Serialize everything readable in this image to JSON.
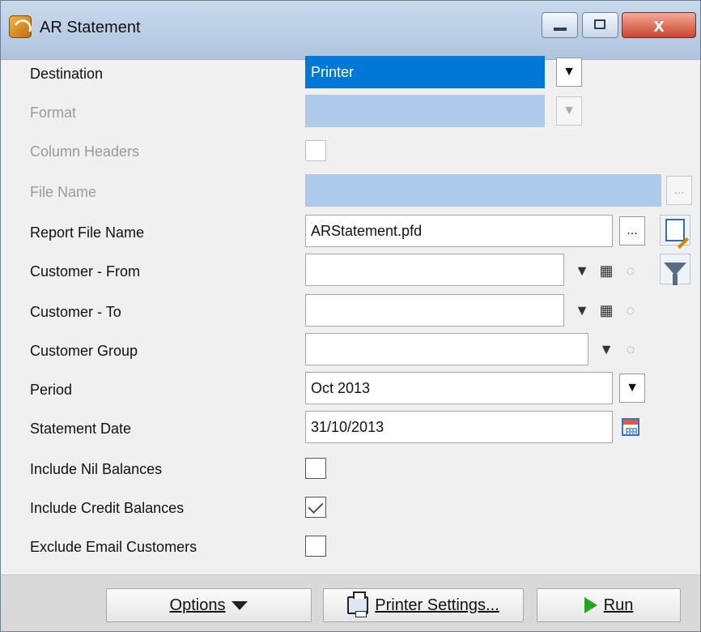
{
  "window": {
    "title": "AR Statement",
    "close_symbol": "x"
  },
  "labels": {
    "destination": "Destination",
    "format": "Format",
    "column_headers": "Column Headers",
    "file_name": "File Name",
    "report_file_name": "Report File Name",
    "customer_from": "Customer - From",
    "customer_to": "Customer - To",
    "customer_group": "Customer Group",
    "period": "Period",
    "statement_date": "Statement Date",
    "include_nil_balances": "Include Nil Balances",
    "include_credit_balances": "Include Credit Balances",
    "exclude_email_customers": "Exclude Email Customers"
  },
  "values": {
    "destination": "Printer",
    "format": "",
    "file_name": "",
    "report_file_name": "ARStatement.pfd",
    "customer_from": "",
    "customer_to": "",
    "customer_group": "",
    "period": "Oct 2013",
    "statement_date": "31/10/2013"
  },
  "buttons": {
    "dropdown": "▼",
    "ellipsis": "...",
    "options_label": "Options",
    "printer_settings_label": "Printer Settings...",
    "run_label": "Run"
  },
  "checkboxes": {
    "column_headers": false,
    "include_nil_balances": false,
    "include_credit_balances": true,
    "exclude_email_customers": false
  },
  "icons": {
    "app": "app-icon",
    "binoculars": "binoculars-icon",
    "lightbulb": "lightbulb-icon",
    "edit_report": "edit-report-icon",
    "filter": "filter-icon",
    "calendar": "calendar-icon",
    "printer": "printer-icon",
    "run": "run-icon"
  }
}
